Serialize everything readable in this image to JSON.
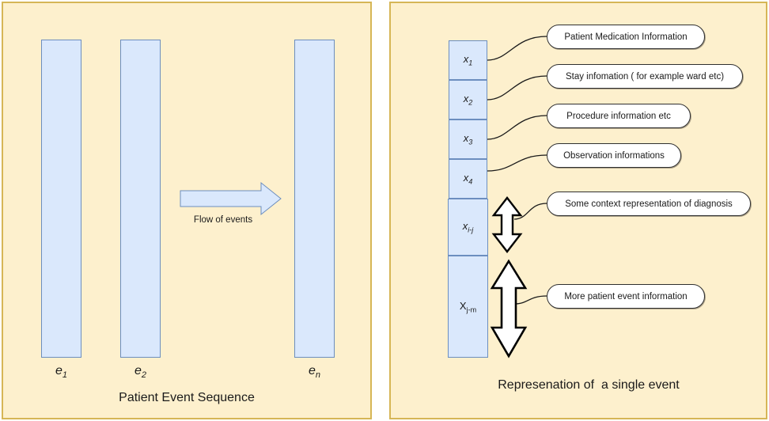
{
  "diagram": {
    "title": "Patient event sequence and single event representation",
    "colors": {
      "panel_fill": "#fdf0cd",
      "panel_border": "#d6b656",
      "box_fill": "#dae8fc",
      "box_border": "#6c8ebf",
      "bubble_fill": "#ffffff",
      "bubble_border": "#2f2f2f",
      "text": "#1a1a1a"
    }
  },
  "left_panel": {
    "caption": "Patient Event Sequence",
    "flow_label": "Flow of events",
    "events": [
      {
        "id": "e1",
        "label_base": "e",
        "label_sub": "1"
      },
      {
        "id": "e2",
        "label_base": "e",
        "label_sub": "2"
      },
      {
        "id": "en",
        "label_base": "e",
        "label_sub": "n"
      }
    ]
  },
  "right_panel": {
    "caption": "Represenation of  a single event",
    "cells": [
      {
        "id": "x1",
        "base": "x",
        "sub": "1",
        "italic": true
      },
      {
        "id": "x2",
        "base": "x",
        "sub": "2",
        "italic": true
      },
      {
        "id": "x3",
        "base": "x",
        "sub": "3",
        "italic": true
      },
      {
        "id": "x4",
        "base": "x",
        "sub": "4",
        "italic": true
      },
      {
        "id": "xij",
        "base": "x",
        "sub": "i-j",
        "italic": true
      },
      {
        "id": "xjm",
        "base": "X",
        "sub": "j-m",
        "italic": false
      }
    ],
    "callouts": [
      {
        "id": "callout-1",
        "text": "Patient Medication Information",
        "source_cell": "x1"
      },
      {
        "id": "callout-2",
        "text": "Stay infomation ( for example ward etc)",
        "source_cell": "x2"
      },
      {
        "id": "callout-3",
        "text": "Procedure information etc",
        "source_cell": "x3"
      },
      {
        "id": "callout-4",
        "text": "Observation informations",
        "source_cell": "x4"
      },
      {
        "id": "callout-5",
        "text": "Some context representation of diagnosis",
        "source_cell": "xij"
      },
      {
        "id": "callout-6",
        "text": "More patient event information",
        "source_cell": "xjm"
      }
    ],
    "range_markers": [
      {
        "id": "range-marker-top",
        "spans_cell": "xij"
      },
      {
        "id": "range-marker-bottom",
        "spans_cell": "xjm"
      }
    ]
  }
}
